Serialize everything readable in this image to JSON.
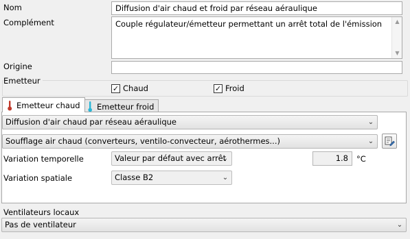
{
  "fields": {
    "nom_label": "Nom",
    "nom_value": "Diffusion d'air chaud et froid par réseau aéraulique",
    "complement_label": "Complément",
    "complement_value": "Couple régulateur/émetteur permettant un arrêt total de l'émission",
    "origine_label": "Origine",
    "origine_value": ""
  },
  "emetteur": {
    "group_label": "Emetteur",
    "chaud_label": "Chaud",
    "chaud_checked": true,
    "froid_label": "Froid",
    "froid_checked": true
  },
  "tabs": [
    {
      "label": "Emetteur chaud",
      "icon": "thermometer-hot-icon",
      "active": true
    },
    {
      "label": "Emetteur froid",
      "icon": "thermometer-cold-icon",
      "active": false
    }
  ],
  "panel": {
    "diffusion_select": "Diffusion d'air chaud par réseau aéraulique",
    "soufflage_select": "Soufflage air chaud (converteurs, ventilo-convecteur, aérothermes...)",
    "variation_temporelle_label": "Variation temporelle",
    "variation_temporelle_value": "Valeur par défaut avec arrêt",
    "temperature_value": "1.8",
    "temperature_unit": "°C",
    "variation_spatiale_label": "Variation spatiale",
    "variation_spatiale_value": "Classe B2"
  },
  "ventilateurs": {
    "label": "Ventilateurs locaux",
    "value": "Pas de ventilateur"
  },
  "colors": {
    "hot_icon": "#c0392b",
    "cold_icon": "#29b6d6"
  }
}
